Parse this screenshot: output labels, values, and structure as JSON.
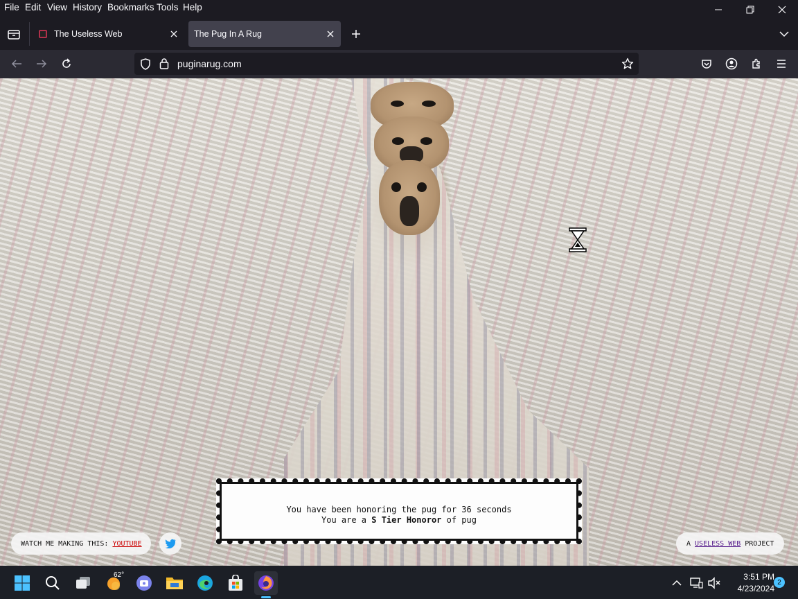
{
  "menu": {
    "items": [
      "File",
      "Edit",
      "View",
      "History",
      "Bookmarks",
      "Tools",
      "Help"
    ]
  },
  "tabs": [
    {
      "title": "The Useless Web",
      "active": false
    },
    {
      "title": "The Pug In A Rug",
      "active": true
    }
  ],
  "address": {
    "url": "puginarug.com"
  },
  "page": {
    "counter_line1": "You have been honoring the pug for 36 seconds",
    "counter_line2_prefix": "You are a ",
    "counter_tier": "S Tier Honoror",
    "counter_line2_suffix": " of pug",
    "watch_label": "WATCH ME MAKING THIS:",
    "youtube_link": "YOUTUBE",
    "project_prefix": "A",
    "useless_web_link": "USELESS WEB",
    "project_suffix": "PROJECT"
  },
  "taskbar": {
    "weather": "62°",
    "time": "3:51 PM",
    "date": "4/23/2024",
    "notifications": "2"
  },
  "colors": {
    "accent": "#4cc2ff",
    "link_red": "#cc0000",
    "link_purple": "#551a8b"
  }
}
